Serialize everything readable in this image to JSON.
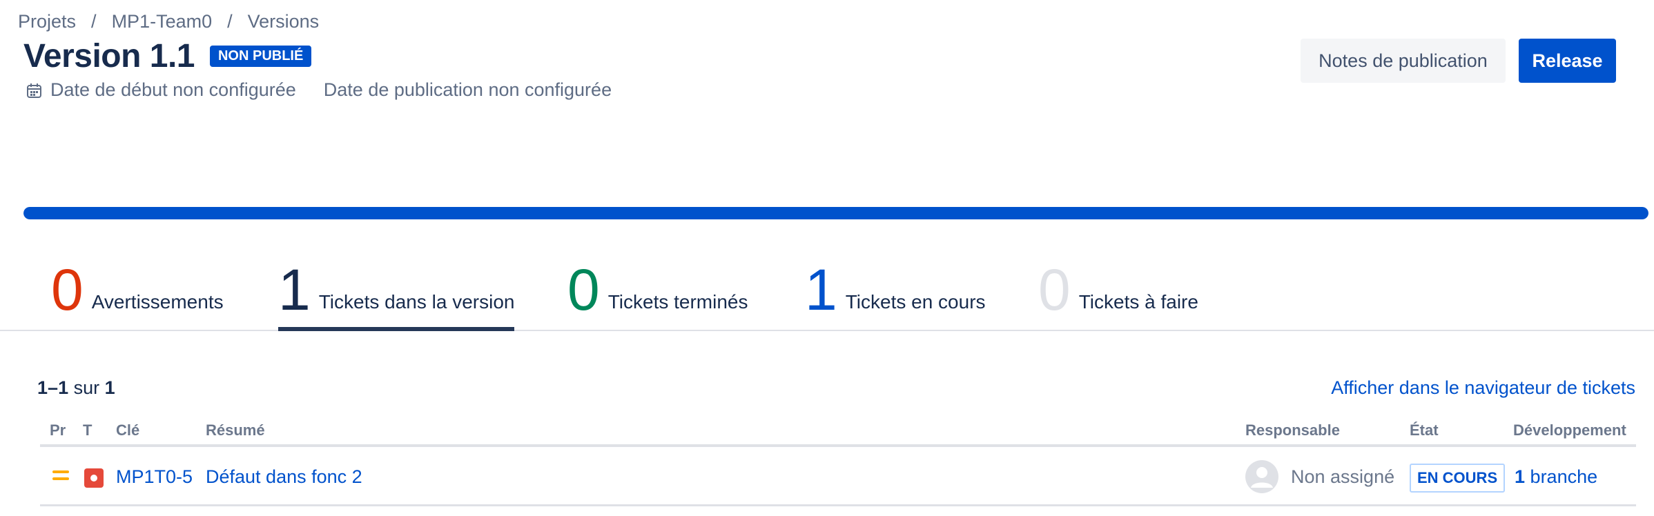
{
  "breadcrumb": {
    "items": [
      "Projets",
      "MP1-Team0",
      "Versions"
    ],
    "separator": "/"
  },
  "version": {
    "title": "Version 1.1",
    "status_badge": "NON PUBLIÉ",
    "start_date": "Date de début non configurée",
    "release_date": "Date de publication non configurée",
    "progress_percent": 100
  },
  "actions": {
    "notes_label": "Notes de publication",
    "release_label": "Release"
  },
  "stats": [
    {
      "count": "0",
      "label": "Avertissements",
      "color": "#de350b"
    },
    {
      "count": "1",
      "label": "Tickets dans la version",
      "color": "#172b4d",
      "active": true
    },
    {
      "count": "0",
      "label": "Tickets terminés",
      "color": "#00875a"
    },
    {
      "count": "1",
      "label": "Tickets en cours",
      "color": "#0052cc"
    },
    {
      "count": "0",
      "label": "Tickets à faire",
      "color": "#dfe1e6"
    }
  ],
  "results": {
    "from": "1",
    "dash": "–",
    "to": "1",
    "of_word": "sur",
    "total": "1",
    "issue_nav_link": "Afficher dans le navigateur de tickets"
  },
  "table": {
    "headers": {
      "priority": "Pr",
      "type": "T",
      "key": "Clé",
      "summary": "Résumé",
      "assignee": "Responsable",
      "status": "État",
      "development": "Développement"
    },
    "rows": [
      {
        "priority_icon": "medium-priority-icon",
        "type_icon": "bug-icon",
        "key": "MP1T0-5",
        "summary": "Défaut dans fonc 2",
        "assignee": "Non assigné",
        "status": "EN COURS",
        "dev_count": "1",
        "dev_label": "branche"
      }
    ]
  }
}
